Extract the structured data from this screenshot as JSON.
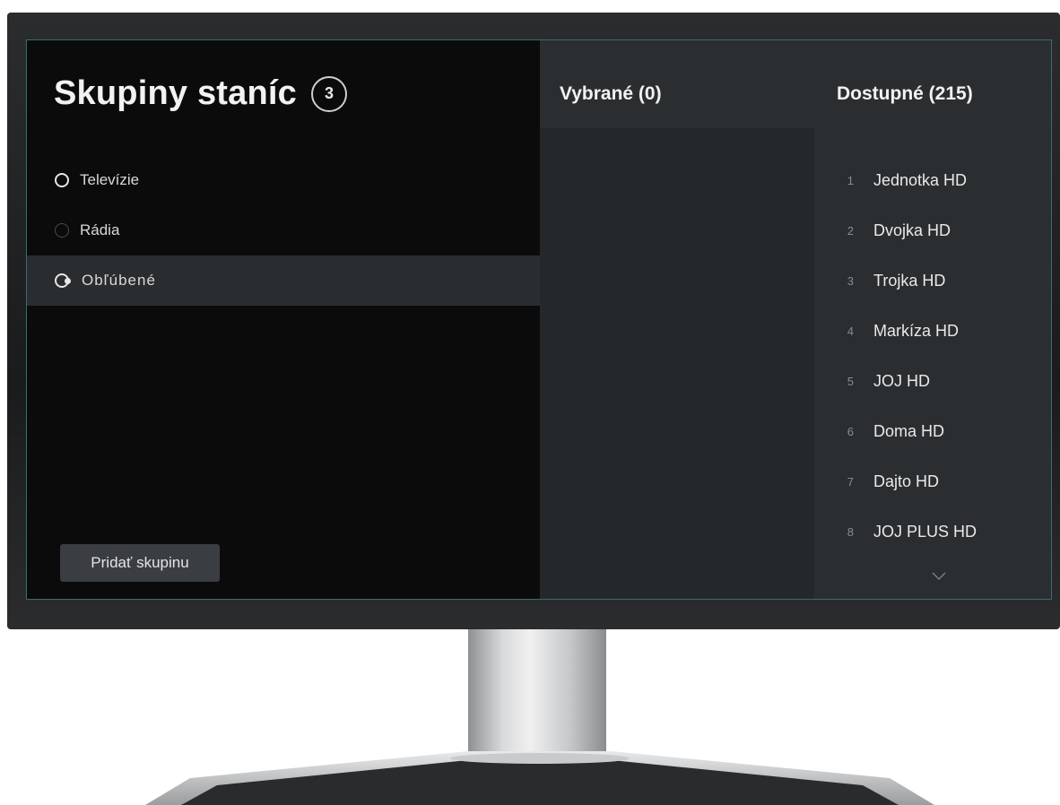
{
  "groups_panel": {
    "title": "Skupiny staníc",
    "count": "3",
    "groups": [
      {
        "label": "Televízie",
        "state": "on"
      },
      {
        "label": "Rádia",
        "state": "off"
      },
      {
        "label": "Obľúbené",
        "state": "focus"
      }
    ],
    "add_button": "Pridať skupinu"
  },
  "selected_panel": {
    "title": "Vybrané (0)"
  },
  "available_panel": {
    "title": "Dostupné (215)",
    "channels": [
      {
        "num": "1",
        "name": "Jednotka HD"
      },
      {
        "num": "2",
        "name": "Dvojka HD"
      },
      {
        "num": "3",
        "name": "Trojka HD"
      },
      {
        "num": "4",
        "name": "Markíza HD"
      },
      {
        "num": "5",
        "name": "JOJ HD"
      },
      {
        "num": "6",
        "name": "Doma HD"
      },
      {
        "num": "7",
        "name": "Dajto HD"
      },
      {
        "num": "8",
        "name": "JOJ PLUS HD"
      }
    ]
  },
  "icons": {
    "scroll_down": "chevron-down-icon",
    "radio": "radio-icon"
  },
  "colors": {
    "background": "#0b0b0b",
    "panel_dark": "#25282b",
    "panel_light": "#2b2e31",
    "text": "#e9e9e9",
    "muted": "#8a8c8f"
  }
}
